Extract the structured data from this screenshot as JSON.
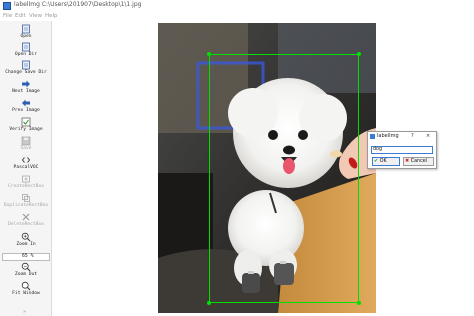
{
  "window": {
    "title": "labelImg C:\\Users\\201907\\Desktop\\1\\1.jpg"
  },
  "menu": {
    "items": [
      "File",
      "Edit",
      "View",
      "Help"
    ]
  },
  "toolbar": {
    "open": "Open",
    "open_dir": "Open Dir",
    "change_save_dir": "Change Save Dir",
    "next_image": "Next Image",
    "prev_image": "Prev Image",
    "verify_image": "Verify Image",
    "save": "Save",
    "format": "PascalVOC",
    "create_rectbox": "CreateRectBox",
    "duplicate_rectbox": "DuplicateRectBox",
    "delete_rectbox": "DeleteRectBox",
    "zoom_in": "Zoom In",
    "zoom_value": "65 %",
    "zoom_out": "Zoom Out",
    "fit_window": "Fit Window"
  },
  "dialog": {
    "title": "labelImg",
    "help": "?",
    "close": "×",
    "label_value": "dog",
    "ok_label": "OK",
    "cancel_label": "Cancel"
  },
  "colors": {
    "bbox": "#00e000",
    "accent": "#3a7bd5"
  }
}
